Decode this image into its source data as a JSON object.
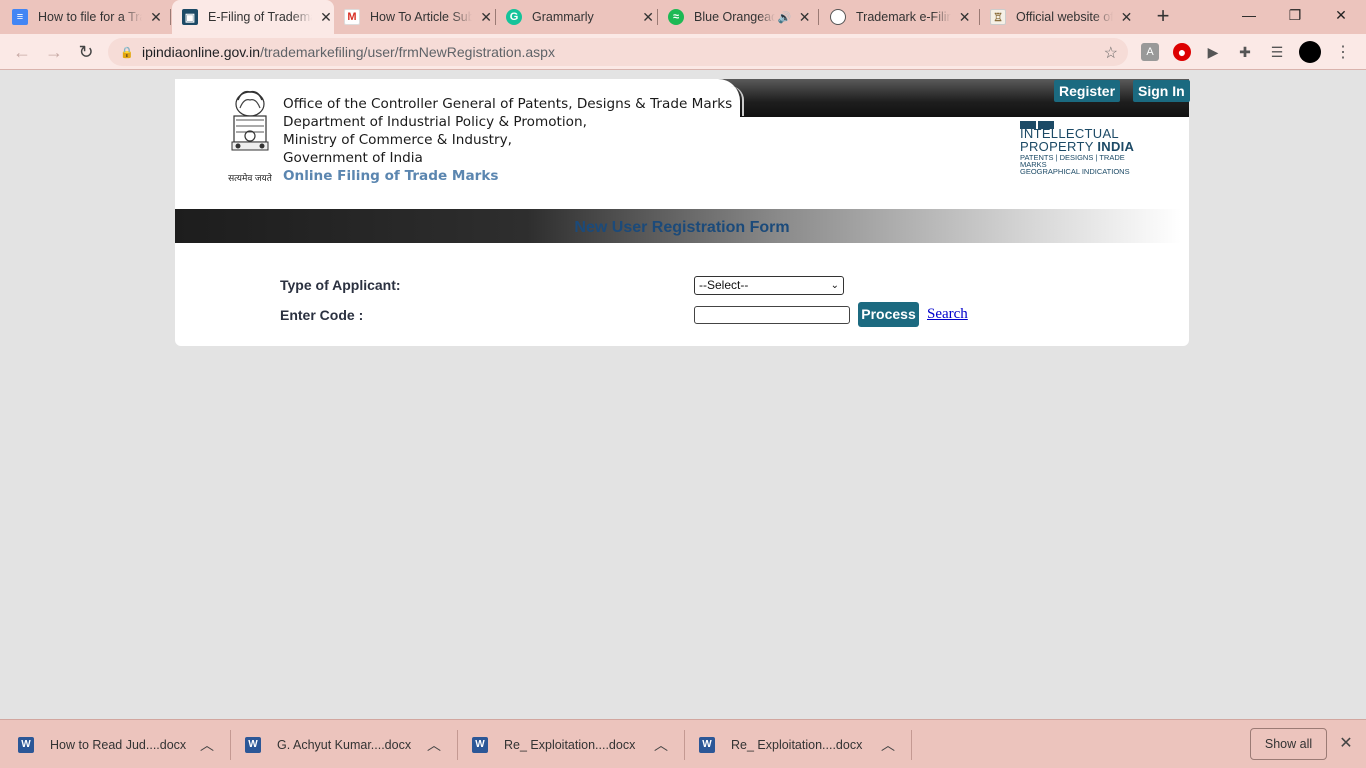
{
  "browser": {
    "tabs": [
      {
        "title": "How to file for a Trademark",
        "icon": "google-docs-icon",
        "color": "#4285f4",
        "active": false
      },
      {
        "title": "E-Filing of Trademark",
        "icon": "ipindia-icon",
        "color": "#1c4a66",
        "active": true
      },
      {
        "title": "How To Article Submission",
        "icon": "gmail-icon",
        "color": "#d93025",
        "active": false
      },
      {
        "title": "Grammarly",
        "icon": "grammarly-icon",
        "color": "#15c39a",
        "active": false
      },
      {
        "title": "Blue Orangeade",
        "icon": "spotify-icon",
        "color": "#1db954",
        "active": false
      },
      {
        "title": "Trademark e-Filing",
        "icon": "globe-icon",
        "color": "#555555",
        "active": false
      },
      {
        "title": "Official website of",
        "icon": "emblem-icon",
        "color": "#8a6d3b",
        "active": false
      }
    ],
    "new_tab": "+",
    "window": {
      "minimize": "—",
      "restore": "❐",
      "close": "✕"
    },
    "url_host": "ipindiaonline.gov.in",
    "url_path": "/trademarkefiling/user/frmNewRegistration.aspx"
  },
  "header": {
    "register_label": "Register",
    "signin_label": "Sign In",
    "emblem_caption": "सत्यमेव जयते",
    "office_lines": [
      "Office of the Controller General of Patents, Designs & Trade Marks",
      "Department of Industrial Policy & Promotion,",
      "Ministry of Commerce & Industry,",
      "Government of India"
    ],
    "subtitle": "Online Filing of Trade Marks",
    "logo": {
      "line1": "INTELLECTUAL",
      "line2a": "PROPERTY ",
      "line2b": "INDIA",
      "line3": "PATENTS | DESIGNS | TRADE MARKS",
      "line4": "GEOGRAPHICAL INDICATIONS"
    }
  },
  "form": {
    "title": "New User Registration Form",
    "type_label": "Type of Applicant:",
    "type_selected": "--Select--",
    "code_label": "Enter Code :",
    "code_value": "",
    "process_label": "Process",
    "search_label": "Search"
  },
  "downloads": {
    "items": [
      "How to Read Jud....docx",
      "G. Achyut Kumar....docx",
      "Re_ Exploitation....docx",
      "Re_ Exploitation....docx"
    ],
    "show_all": "Show all"
  },
  "colors": {
    "chrome": "#ecc4bd",
    "toolbar": "#fbe9e6",
    "teal_button": "#1c6a80",
    "title_blue": "#1b4a7a"
  }
}
